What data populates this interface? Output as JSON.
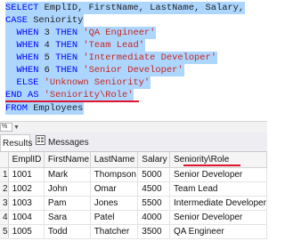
{
  "query": {
    "line1": {
      "select": "SELECT",
      "cols": " EmplID, FirstName, LastName, Salary,"
    },
    "line2": {
      "case": "CASE",
      "col": " Seniority"
    },
    "whens": [
      {
        "when": "WHEN",
        "num": " 3 ",
        "then": "THEN",
        "value": " 'QA Engineer'"
      },
      {
        "when": "WHEN",
        "num": " 4 ",
        "then": "THEN",
        "value": " 'Team Lead'"
      },
      {
        "when": "WHEN",
        "num": " 5 ",
        "then": "THEN",
        "value": " 'Intermediate Developer'"
      },
      {
        "when": "WHEN",
        "num": " 6 ",
        "then": "THEN",
        "value": " 'Senior Developer'"
      }
    ],
    "else_line": {
      "else": "ELSE",
      "value": " 'Unknown Seniority'"
    },
    "end_line": {
      "end": "END",
      "as": " AS",
      "alias": " 'Seniority\\Role'"
    },
    "from_line": {
      "from": "FROM",
      "table": " Employees"
    }
  },
  "zoom_label": "%",
  "tabs": {
    "results": "Results",
    "messages": "Messages"
  },
  "results": {
    "columns": [
      "EmplID",
      "FirstName",
      "LastName",
      "Salary",
      "Seniority\\Role"
    ],
    "rows": [
      {
        "num": "1",
        "cells": [
          "1001",
          "Mark",
          "Thompson",
          "5000",
          "Senior Developer"
        ]
      },
      {
        "num": "2",
        "cells": [
          "1002",
          "John",
          "Omar",
          "4500",
          "Team Lead"
        ]
      },
      {
        "num": "3",
        "cells": [
          "1003",
          "Pam",
          "Jones",
          "5500",
          "Intermediate Developer"
        ]
      },
      {
        "num": "4",
        "cells": [
          "1004",
          "Sara",
          "Patel",
          "4000",
          "Senior Developer"
        ]
      },
      {
        "num": "5",
        "cells": [
          "1005",
          "Todd",
          "Thatcher",
          "3500",
          "QA Engineer"
        ]
      }
    ]
  },
  "colors": {
    "keyword": "#0000ff",
    "string": "#c7251d",
    "selection": "#add6ff",
    "underline": "#e0142a"
  }
}
